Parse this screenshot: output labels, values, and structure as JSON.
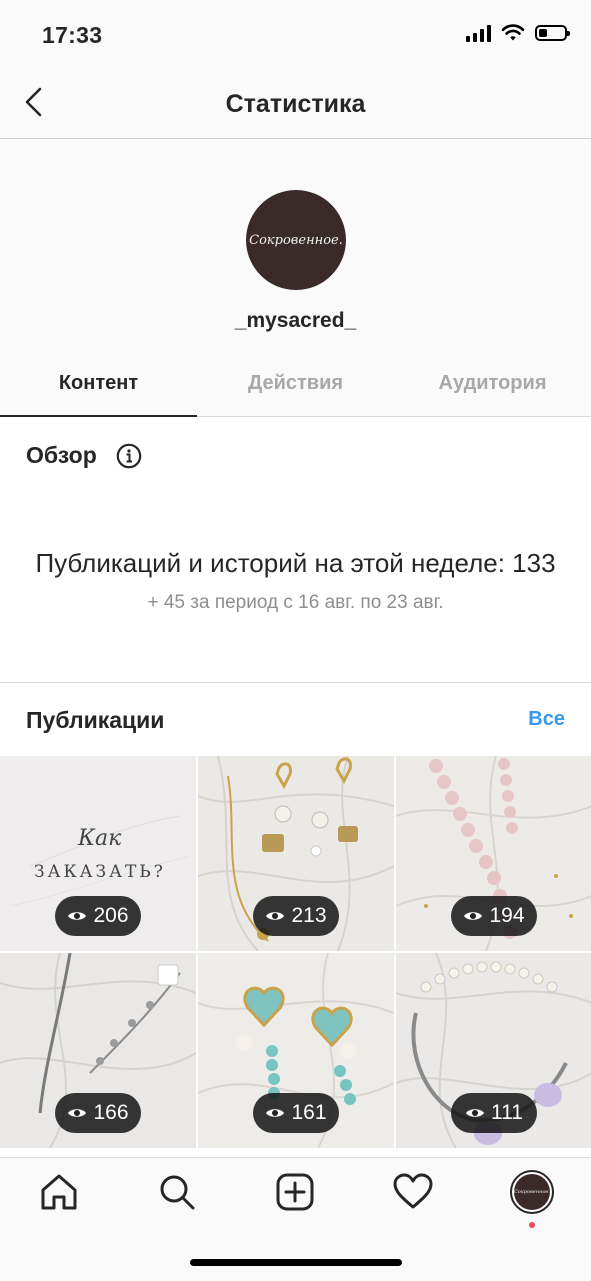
{
  "status": {
    "time": "17:33",
    "battery_level": 0.35
  },
  "nav": {
    "title": "Статистика",
    "back_icon": "chevron-left-icon"
  },
  "profile": {
    "username": "_mysacred_",
    "avatar_text": "Сокровенное."
  },
  "tabs": [
    {
      "label": "Контент",
      "active": true
    },
    {
      "label": "Действия",
      "active": false
    },
    {
      "label": "Аудитория",
      "active": false
    }
  ],
  "overview": {
    "title": "Обзор",
    "main": "Публикаций и историй на этой неделе: 133",
    "sub": "+ 45 за период с 16 авг. по 23 авг."
  },
  "publications": {
    "title": "Публикации",
    "all_label": "Все",
    "posts": [
      {
        "views": "206",
        "caption_script": "Как",
        "caption_caps": "ЗАКАЗАТЬ?"
      },
      {
        "views": "213"
      },
      {
        "views": "194"
      },
      {
        "views": "166"
      },
      {
        "views": "161"
      },
      {
        "views": "111"
      }
    ]
  },
  "tab_bar": {
    "items": [
      "home-icon",
      "search-icon",
      "add-post-icon",
      "heart-icon",
      "profile-avatar"
    ]
  },
  "colors": {
    "accent": "#3897f0",
    "text": "#262626",
    "muted": "#8e8e8e",
    "notification": "#ed4956"
  }
}
